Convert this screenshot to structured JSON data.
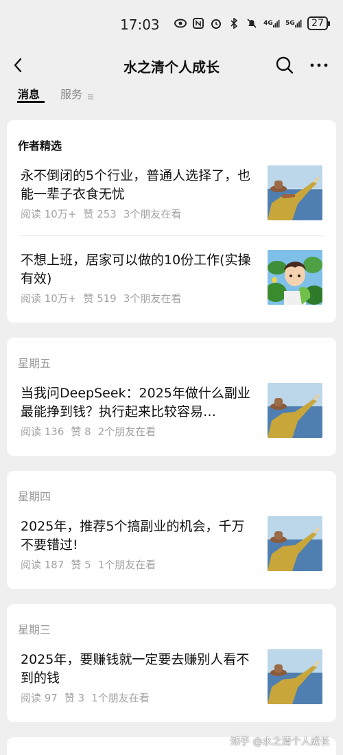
{
  "status_bar": {
    "time": "17:03",
    "icons": [
      "eye-icon",
      "nfc-icon",
      "alarm-icon",
      "bluetooth-icon",
      "mute-icon",
      "4g-signal-icon",
      "5g-signal-icon"
    ],
    "net_4g": "4G",
    "net_5g": "5G",
    "battery": "27"
  },
  "header": {
    "title": "水之清个人成长",
    "back_icon": "back-arrow-icon",
    "search_icon": "search-icon",
    "more_icon": "more-icon"
  },
  "tabs": [
    {
      "label": "消息",
      "active": true
    },
    {
      "label": "服务",
      "active": false
    }
  ],
  "sections": [
    {
      "title": "作者精选",
      "articles": [
        {
          "title": "永不倒闭的5个行业，普通人选择了，也能一辈子衣食无忧",
          "reads": "阅读 10万+",
          "likes": "赞 253",
          "friends": "3个朋友在看",
          "thumb": "girl-with-hat-by-sea"
        },
        {
          "title": "不想上班，居家可以做的10份工作(实操有效)",
          "reads": "阅读 10万+",
          "likes": "赞 519",
          "friends": "3个朋友在看",
          "thumb": "anime-boy-with-leaves"
        }
      ]
    },
    {
      "title": "星期五",
      "articles": [
        {
          "title": "当我问DeepSeek：2025年做什么副业最能挣到钱？执行起来比较容易…",
          "reads": "阅读 136",
          "likes": "赞 8",
          "friends": "2个朋友在看",
          "thumb": "girl-with-hat-by-sea"
        }
      ]
    },
    {
      "title": "星期四",
      "articles": [
        {
          "title": "2025年，推荐5个搞副业的机会，千万不要错过!",
          "reads": "阅读 187",
          "likes": "赞 5",
          "friends": "1个朋友在看",
          "thumb": "girl-with-hat-by-sea"
        }
      ]
    },
    {
      "title": "星期三",
      "articles": [
        {
          "title": "2025年，要赚钱就一定要去赚别人看不到的钱",
          "reads": "阅读 97",
          "likes": "赞 3",
          "friends": "1个朋友在看",
          "thumb": "girl-with-hat-by-sea"
        }
      ]
    }
  ],
  "watermark": "知乎 @水之清个人成长",
  "colors": {
    "background": "#efefef",
    "card": "#ffffff",
    "meta_text": "#a3a3a3",
    "day_text": "#9a9a9a"
  }
}
